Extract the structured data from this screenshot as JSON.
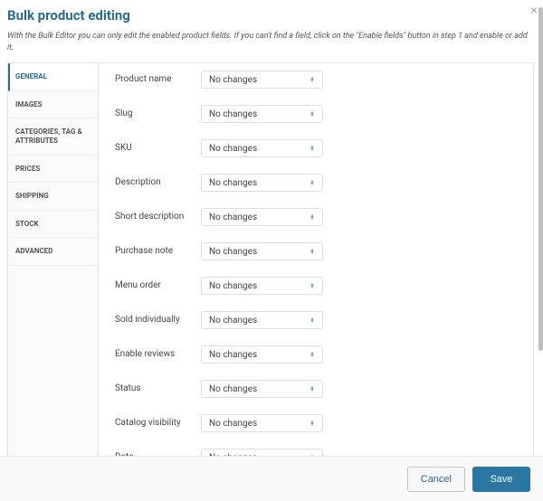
{
  "title": "Bulk product editing",
  "subtitle": "With the Bulk Editor you can only edit the enabled product fields. If you can't find a field, click on the \"Enable fields\" button in step 1 and enable or add it.",
  "tabs": [
    {
      "label": "GENERAL"
    },
    {
      "label": "IMAGES"
    },
    {
      "label": "CATEGORIES, TAG & ATTRIBUTES"
    },
    {
      "label": "PRICES"
    },
    {
      "label": "SHIPPING"
    },
    {
      "label": "STOCK"
    },
    {
      "label": "ADVANCED"
    }
  ],
  "fields": [
    {
      "label": "Product name",
      "value": "No changes"
    },
    {
      "label": "Slug",
      "value": "No changes"
    },
    {
      "label": "SKU",
      "value": "No changes"
    },
    {
      "label": "Description",
      "value": "No changes"
    },
    {
      "label": "Short description",
      "value": "No changes"
    },
    {
      "label": "Purchase note",
      "value": "No changes"
    },
    {
      "label": "Menu order",
      "value": "No changes"
    },
    {
      "label": "Sold individually",
      "value": "No changes"
    },
    {
      "label": "Enable reviews",
      "value": "No changes"
    },
    {
      "label": "Status",
      "value": "No changes"
    },
    {
      "label": "Catalog visibility",
      "value": "No changes"
    },
    {
      "label": "Date",
      "value": "No changes"
    }
  ],
  "footer": {
    "cancel": "Cancel",
    "save": "Save"
  }
}
